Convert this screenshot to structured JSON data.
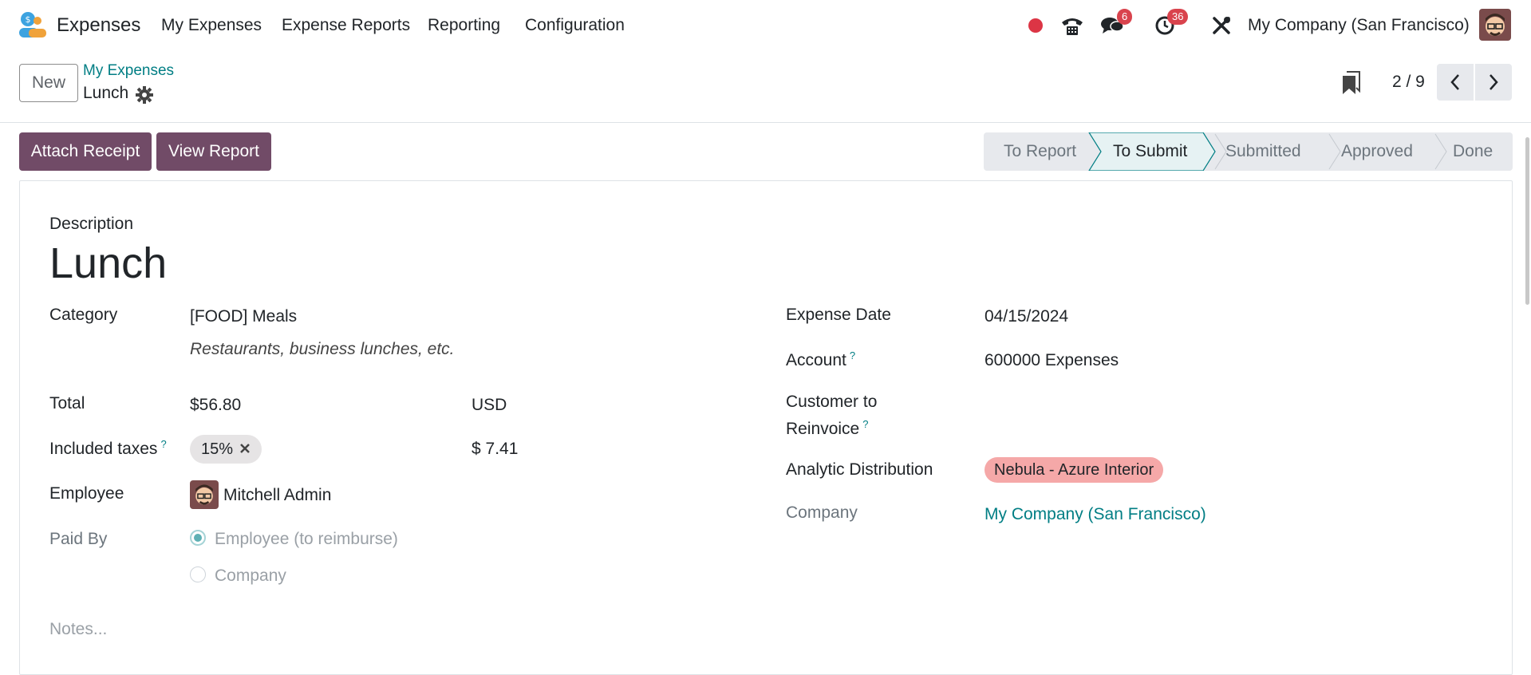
{
  "navbar": {
    "app_name": "Expenses",
    "menus": [
      "My Expenses",
      "Expense Reports",
      "Reporting",
      "Configuration"
    ],
    "messages_badge": "6",
    "activities_badge": "36",
    "company": "My Company (San Francisco)"
  },
  "control_panel": {
    "new_label": "New",
    "breadcrumb_parent": "My Expenses",
    "breadcrumb_current": "Lunch",
    "pager": "2 / 9"
  },
  "actions": {
    "attach_receipt": "Attach Receipt",
    "view_report": "View Report"
  },
  "status": {
    "steps": [
      "To Report",
      "To Submit",
      "Submitted",
      "Approved",
      "Done"
    ],
    "active": "To Submit"
  },
  "form": {
    "description_label": "Description",
    "description_value": "Lunch",
    "category_label": "Category",
    "category_value": "[FOOD] Meals",
    "category_note": "Restaurants, business lunches, etc.",
    "total_label": "Total",
    "total_value": "$56.80",
    "currency": "USD",
    "taxes_label": "Included taxes",
    "taxes_help": "?",
    "tax_tag": "15%",
    "tax_amount": "$ 7.41",
    "employee_label": "Employee",
    "employee_value": "Mitchell Admin",
    "paid_by_label": "Paid By",
    "paid_by_options": [
      "Employee (to reimburse)",
      "Company"
    ],
    "paid_by_selected": "Employee (to reimburse)",
    "notes_placeholder": "Notes...",
    "expense_date_label": "Expense Date",
    "expense_date_value": "04/15/2024",
    "account_label": "Account",
    "account_help": "?",
    "account_value": "600000 Expenses",
    "customer_label_line1": "Customer to",
    "customer_label_line2": "Reinvoice",
    "customer_help": "?",
    "analytic_label": "Analytic Distribution",
    "analytic_tag": "Nebula - Azure Interior",
    "company_label": "Company",
    "company_value": "My Company (San Francisco)"
  },
  "colors": {
    "primary": "#714b67",
    "link": "#017e84",
    "badge": "#d9434d",
    "recording_dot": "#dc3545",
    "analytic_tag": "#f5a8a8"
  },
  "icons": {
    "app": "expenses-logo-icon",
    "record": "record-dot-icon",
    "phone": "phone-icon",
    "chat": "chat-icon",
    "activity": "clock-icon",
    "tools": "tools-icon",
    "gear": "gear-icon",
    "bookmark": "bookmark-icon",
    "prev": "chevron-left-icon",
    "next": "chevron-right-icon",
    "remove": "close-icon"
  }
}
